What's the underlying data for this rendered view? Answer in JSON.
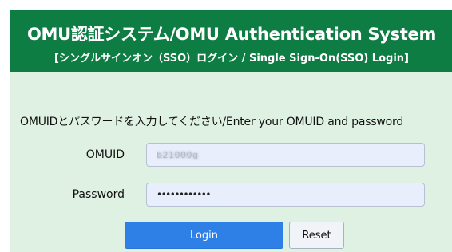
{
  "header": {
    "title": "OMU認証システム/OMU Authentication System",
    "subtitle": "[シングルサインオン（SSO）ログイン / Single Sign-On(SSO) Login]"
  },
  "form": {
    "instruction": "OMUIDとパスワードを入力してください/Enter your OMUID and password",
    "omuid": {
      "label": "OMUID",
      "value": "b21000g"
    },
    "password": {
      "label": "Password",
      "value": "••••••••••••"
    },
    "login_label": "Login",
    "reset_label": "Reset"
  },
  "colors": {
    "header_bg": "#0d7d43",
    "panel_bg": "#dff1e2",
    "primary_button": "#2e7fe6",
    "input_bg": "#e9eefc"
  }
}
